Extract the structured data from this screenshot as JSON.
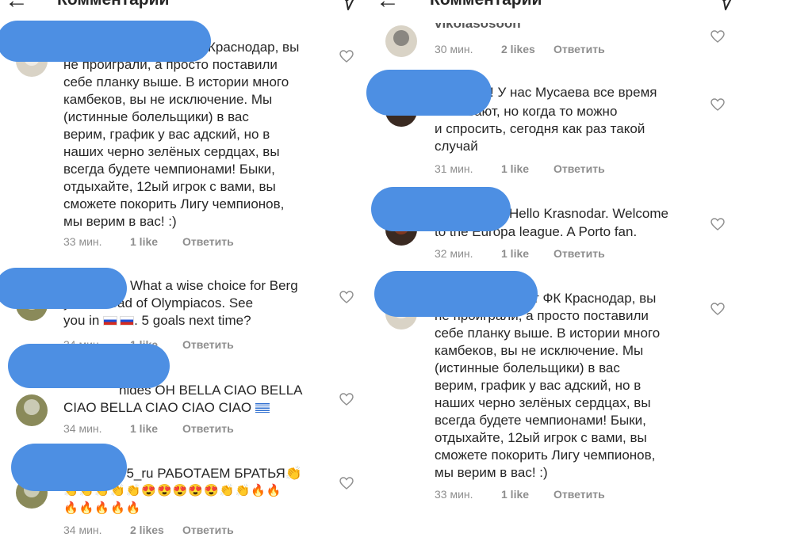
{
  "header": {
    "title": "Комментарии",
    "back_icon": "arrow-left-icon",
    "send_icon": "paper-plane-icon"
  },
  "left_panel": {
    "comments": [
      {
        "lines": [
          "Краснодар, вы",
          "не проиграли, а просто поставили",
          "себе планку выше. В истории много",
          "камбеков, вы не исключение. Мы",
          "(истинные болельщики) в вас",
          "верим,  график у вас адский, но в",
          "наших черно зелёных сердцах, вы",
          "всегда будете чемпионами! Быки,",
          "отдыхайте, 12ый игрок с вами, вы",
          "сможете покорить Лигу чемпионов,",
          "мы верим в вас! :)"
        ],
        "time": "33 мин.",
        "likes": "1 like",
        "reply": "Ответить"
      },
      {
        "lines": [
          "What a wise choice for Berg",
          "you instead of Olympiacos. See",
          "you in",
          ". 5 goals next time?"
        ],
        "time": "34 мин.",
        "likes": "1 like",
        "reply": "Ответить"
      },
      {
        "lines": [
          "nides ΟΗ ΒΕLLA CIAO BELLA",
          "CIAO BELLA CIAO CIAO CIAO"
        ],
        "time": "34 мин.",
        "likes": "1 like",
        "reply": "Ответить"
      },
      {
        "lines": [
          "75_ru РАБОТАЕМ БРАТЬЯ"
        ],
        "emoji_line1": "👏👏👏👏👏😍😍😍😍😍👏👏🔥🔥",
        "emoji_line2": "🔥🔥🔥🔥🔥",
        "time": "34 мин.",
        "likes": "2 likes",
        "reply": "Ответить"
      }
    ]
  },
  "right_panel": {
    "comments": [
      {
        "username": "vikolasosoon",
        "time": "30 мин.",
        "likes": "2 likes",
        "reply": "Ответить"
      },
      {
        "lines": [
          "! У нас Мусаева все время",
          "вызывают, но когда то можно",
          "и спросить, сегодня как раз такой",
          "случай"
        ],
        "time": "31 мин.",
        "likes": "1 like",
        "reply": "Ответить"
      },
      {
        "lines": [
          "Hello Krasnodar. Welcome",
          "to the Europa league. A Porto fan."
        ],
        "time": "32 мин.",
        "likes": "1 like",
        "reply": "Ответить"
      },
      {
        "lines": [
          "т ФК Краснодар, вы",
          "не проиграли, а просто поставили",
          "себе планку выше. В истории много",
          "камбеков, вы не исключение. Мы",
          "(истинные болельщики) в вас",
          "верим,  график у вас адский, но в",
          "наших черно зелёных сердцах, вы",
          "всегда будете чемпионами! Быки,",
          "отдыхайте, 12ый игрок с вами, вы",
          "сможете покорить Лигу чемпионов,",
          "мы верим в вас! :)"
        ],
        "time": "33 мин.",
        "likes": "1 like",
        "reply": "Ответить"
      }
    ]
  },
  "colors": {
    "redaction": "#4d8fe3",
    "meta_text": "#8e8e8e",
    "text": "#262626"
  }
}
